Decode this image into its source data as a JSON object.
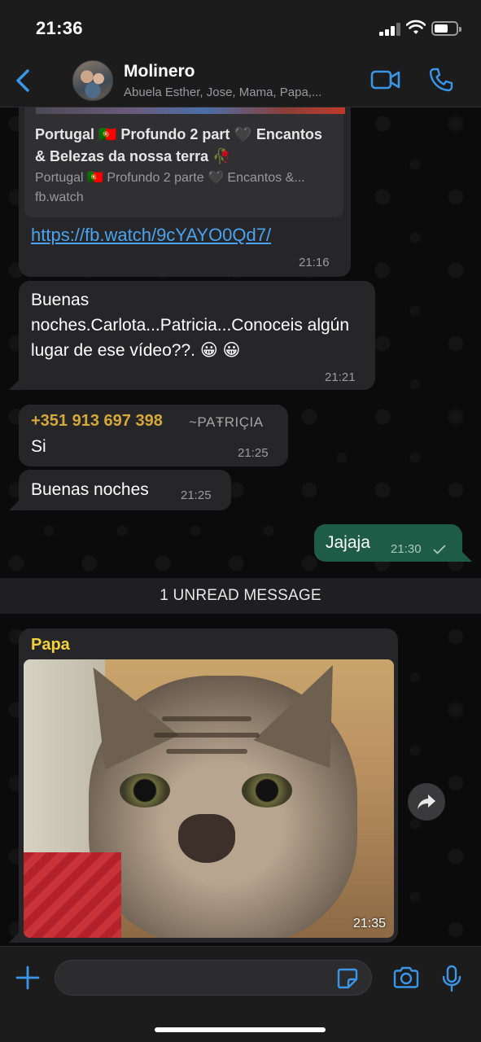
{
  "status_bar": {
    "time": "21:36",
    "battery_level": 0.55,
    "signal_bars": 3
  },
  "header": {
    "back_icon": "chevron-left-icon",
    "chat_name": "Molinero",
    "members": "Abuela Esther, Jose, Mama, Papa,...",
    "video_icon": "video-camera-icon",
    "call_icon": "phone-icon",
    "accent": "#3a96e8"
  },
  "messages": {
    "link_preview": {
      "title": "Portugal 🇵🇹 Profundo 2 part 🖤 Encantos & Belezas da nossa terra 🥀",
      "description": "Portugal 🇵🇹 Profundo 2 parte 🖤 Encantos &...",
      "domain": "fb.watch",
      "url": "https://fb.watch/9cYAYO0Qd7/",
      "time": "21:16"
    },
    "buenas_noches_q": {
      "text": "Buenas noches.Carlota...Patricia...Conoceis algún lugar de ese vídeo??. 😀 😀",
      "time": "21:21"
    },
    "si": {
      "sender": "+351 913 697 398",
      "sender_alias": "~PAŦRIÇIA",
      "sender_color": "#d4a83a",
      "text": "Si",
      "time": "21:25"
    },
    "buenas_noches": {
      "text": "Buenas noches",
      "time": "21:25"
    },
    "jajaja": {
      "text": "Jajaja",
      "time": "21:30",
      "status_icon": "check-icon"
    },
    "unread_label": "1 UNREAD MESSAGE",
    "papa_photo": {
      "sender": "Papa",
      "sender_color": "#f2d23c",
      "time": "21:35",
      "share_icon": "share-arrow-icon"
    }
  },
  "input_bar": {
    "plus_icon": "plus-icon",
    "sticker_icon": "sticker-icon",
    "camera_icon": "camera-icon",
    "mic_icon": "microphone-icon",
    "message_value": ""
  }
}
